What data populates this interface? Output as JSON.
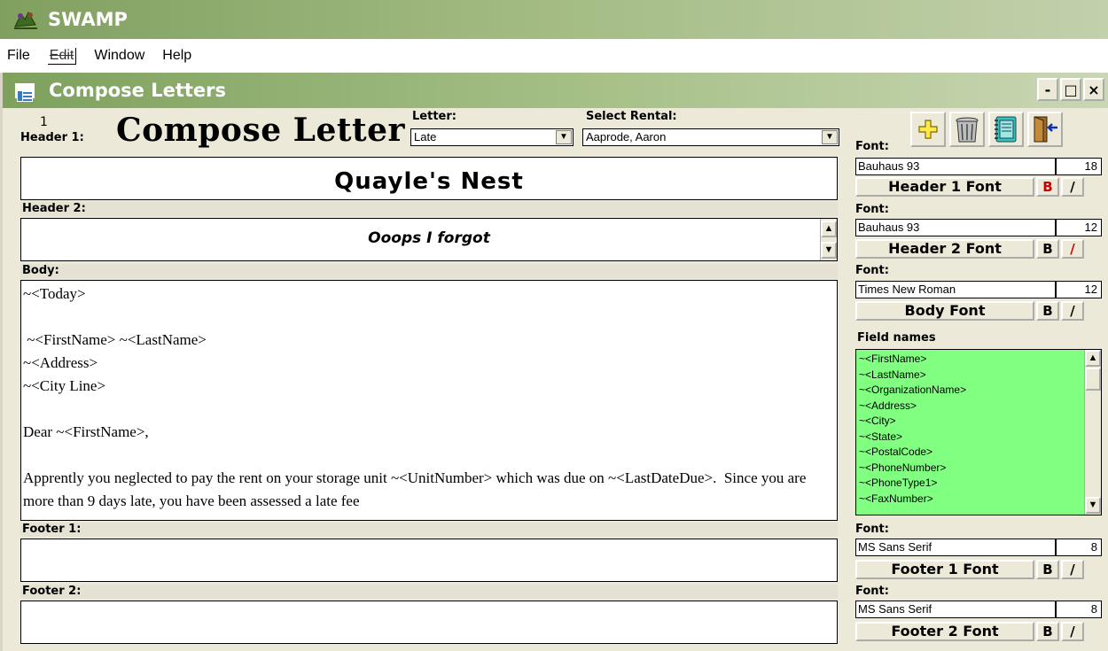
{
  "app": {
    "title": "SWAMP",
    "icon": "swamp-app-icon"
  },
  "menu": {
    "items": [
      "File",
      "Edit",
      "Window",
      "Help"
    ]
  },
  "window": {
    "title": "Compose Letters",
    "minimize": "-",
    "maximize": "□",
    "close": "×"
  },
  "form": {
    "record_number": "1",
    "heading": "Compose Letter",
    "letter_label": "Letter:",
    "letter_value": "Late",
    "rental_label": "Select Rental:",
    "rental_value": "Aaprode, Aaron",
    "header1_label": "Header 1:",
    "header1_text": "Quayle's Nest",
    "header2_label": "Header 2:",
    "header2_text": "Ooops I forgot",
    "body_label": "Body:",
    "body_text": "~<Today>\n\n ~<FirstName> ~<LastName>\n~<Address>\n~<City Line>\n\nDear ~<FirstName>,\n\nApprently you neglected to pay the rent on your storage unit ~<UnitNumber> which was due on ~<LastDateDue>.  Since you are more than 9 days late, you have been assessed a late fee",
    "footer1_label": "Footer 1:",
    "footer1_text": "",
    "footer2_label": "Footer 2:",
    "footer2_text": ""
  },
  "toolbar": {
    "icons": [
      "add-icon",
      "trash-icon",
      "notebook-icon",
      "exit-door-icon"
    ]
  },
  "fonts": {
    "font_label": "Font:",
    "header1": {
      "name": "Bauhaus 93",
      "size": "18",
      "button": "Header 1 Font",
      "bold": "B",
      "italic": "/"
    },
    "header2": {
      "name": "Bauhaus 93",
      "size": "12",
      "button": "Header 2 Font",
      "bold": "B",
      "italic": "/"
    },
    "body": {
      "name": "Times New Roman",
      "size": "12",
      "button": "Body Font",
      "bold": "B",
      "italic": "/"
    },
    "footer1": {
      "name": "MS Sans Serif",
      "size": "8",
      "button": "Footer 1 Font",
      "bold": "B",
      "italic": "/"
    },
    "footer2": {
      "name": "MS Sans Serif",
      "size": "8",
      "button": "Footer 2 Font",
      "bold": "B",
      "italic": "/"
    }
  },
  "field_names": {
    "label": "Field names",
    "items": [
      "~<FirstName>",
      "~<LastName>",
      "~<OrganizationName>",
      "~<Address>",
      "~<City>",
      "~<State>",
      "~<PostalCode>",
      "~<PhoneNumber>",
      "~<PhoneType1>",
      "~<FaxNumber>"
    ]
  },
  "colors": {
    "title_bar": "#80a060",
    "field_list_bg": "#80ff80",
    "active_style": "#cc0000"
  }
}
